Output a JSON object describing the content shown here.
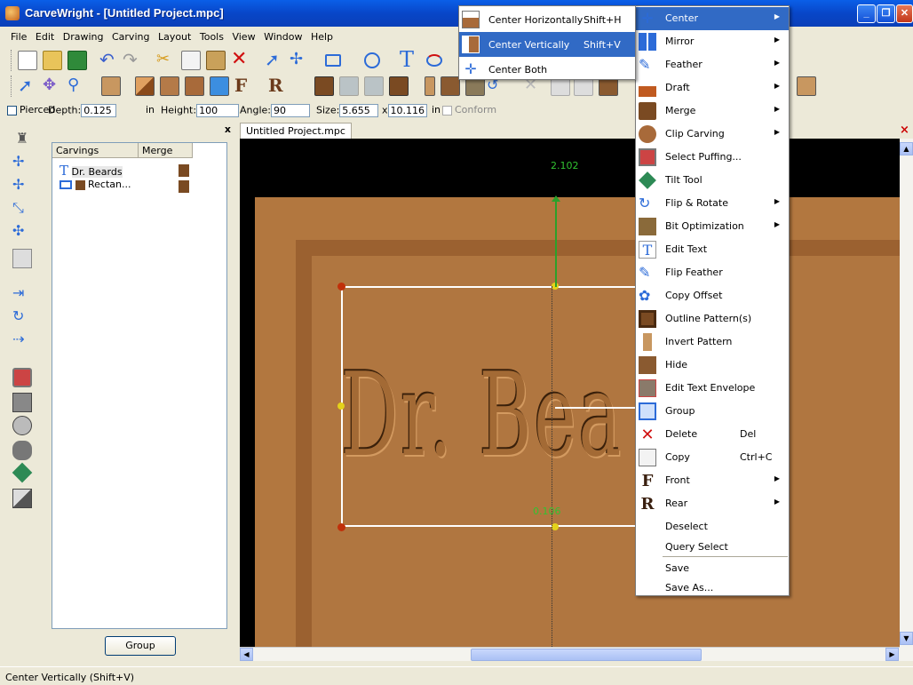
{
  "window": {
    "title": "CarveWright - [Untitled Project.mpc]",
    "minimize": "_",
    "restore": "❐",
    "close": "✕"
  },
  "menubar": [
    "File",
    "Edit",
    "Drawing",
    "Carving",
    "Layout",
    "Tools",
    "View",
    "Window",
    "Help"
  ],
  "propbar": {
    "pierced": "Pierced",
    "depth_label": "Depth:",
    "depth_value": "0.125",
    "depth_unit": "in",
    "height_label": "Height:",
    "height_value": "100",
    "angle_label": "Angle:",
    "angle_value": "90",
    "size_label": "Size:",
    "size_w": "5.655",
    "size_x": "x",
    "size_h": "10.116",
    "size_unit": "in",
    "conform": "Conform"
  },
  "panel": {
    "col_carvings": "Carvings",
    "col_merge": "Merge",
    "items": [
      "Dr. Beards",
      "Rectan..."
    ],
    "group_button": "Group",
    "close": "x"
  },
  "document": {
    "tab": "Untitled Project.mpc",
    "close": "×",
    "dim_top": "2.102",
    "dim_bottom": "0.106",
    "carving_text": "Dr. Bea"
  },
  "context_menu": {
    "items": [
      {
        "label": "Center",
        "arrow": "▶"
      },
      {
        "label": "Mirror",
        "arrow": "▶"
      },
      {
        "label": "Feather",
        "arrow": "▶"
      },
      {
        "label": "Draft",
        "arrow": "▶"
      },
      {
        "label": "Merge",
        "arrow": "▶"
      },
      {
        "label": "Clip Carving",
        "arrow": "▶"
      },
      {
        "label": "Select Puffing..."
      },
      {
        "label": "Tilt Tool"
      },
      {
        "label": "Flip & Rotate",
        "arrow": "▶"
      },
      {
        "label": "Bit Optimization",
        "arrow": "▶"
      },
      {
        "label": "Edit Text"
      },
      {
        "label": "Flip Feather"
      },
      {
        "label": "Copy Offset"
      },
      {
        "label": "Outline Pattern(s)"
      },
      {
        "label": "Invert Pattern"
      },
      {
        "label": "Hide"
      },
      {
        "label": "Edit Text Envelope"
      },
      {
        "label": "Group"
      },
      {
        "label": "Delete",
        "shortcut": "Del"
      },
      {
        "label": "Copy",
        "shortcut": "Ctrl+C"
      },
      {
        "label": "Front",
        "arrow": "▶"
      },
      {
        "label": "Rear",
        "arrow": "▶"
      },
      {
        "label": "Deselect"
      },
      {
        "label": "Query Select"
      },
      {
        "label": "Save"
      },
      {
        "label": "Save As..."
      }
    ]
  },
  "submenu": {
    "items": [
      {
        "label": "Center Horizontally",
        "shortcut": "Shift+H"
      },
      {
        "label": "Center Vertically",
        "shortcut": "Shift+V"
      },
      {
        "label": "Center Both"
      }
    ]
  },
  "status": "Center Vertically (Shift+V)"
}
